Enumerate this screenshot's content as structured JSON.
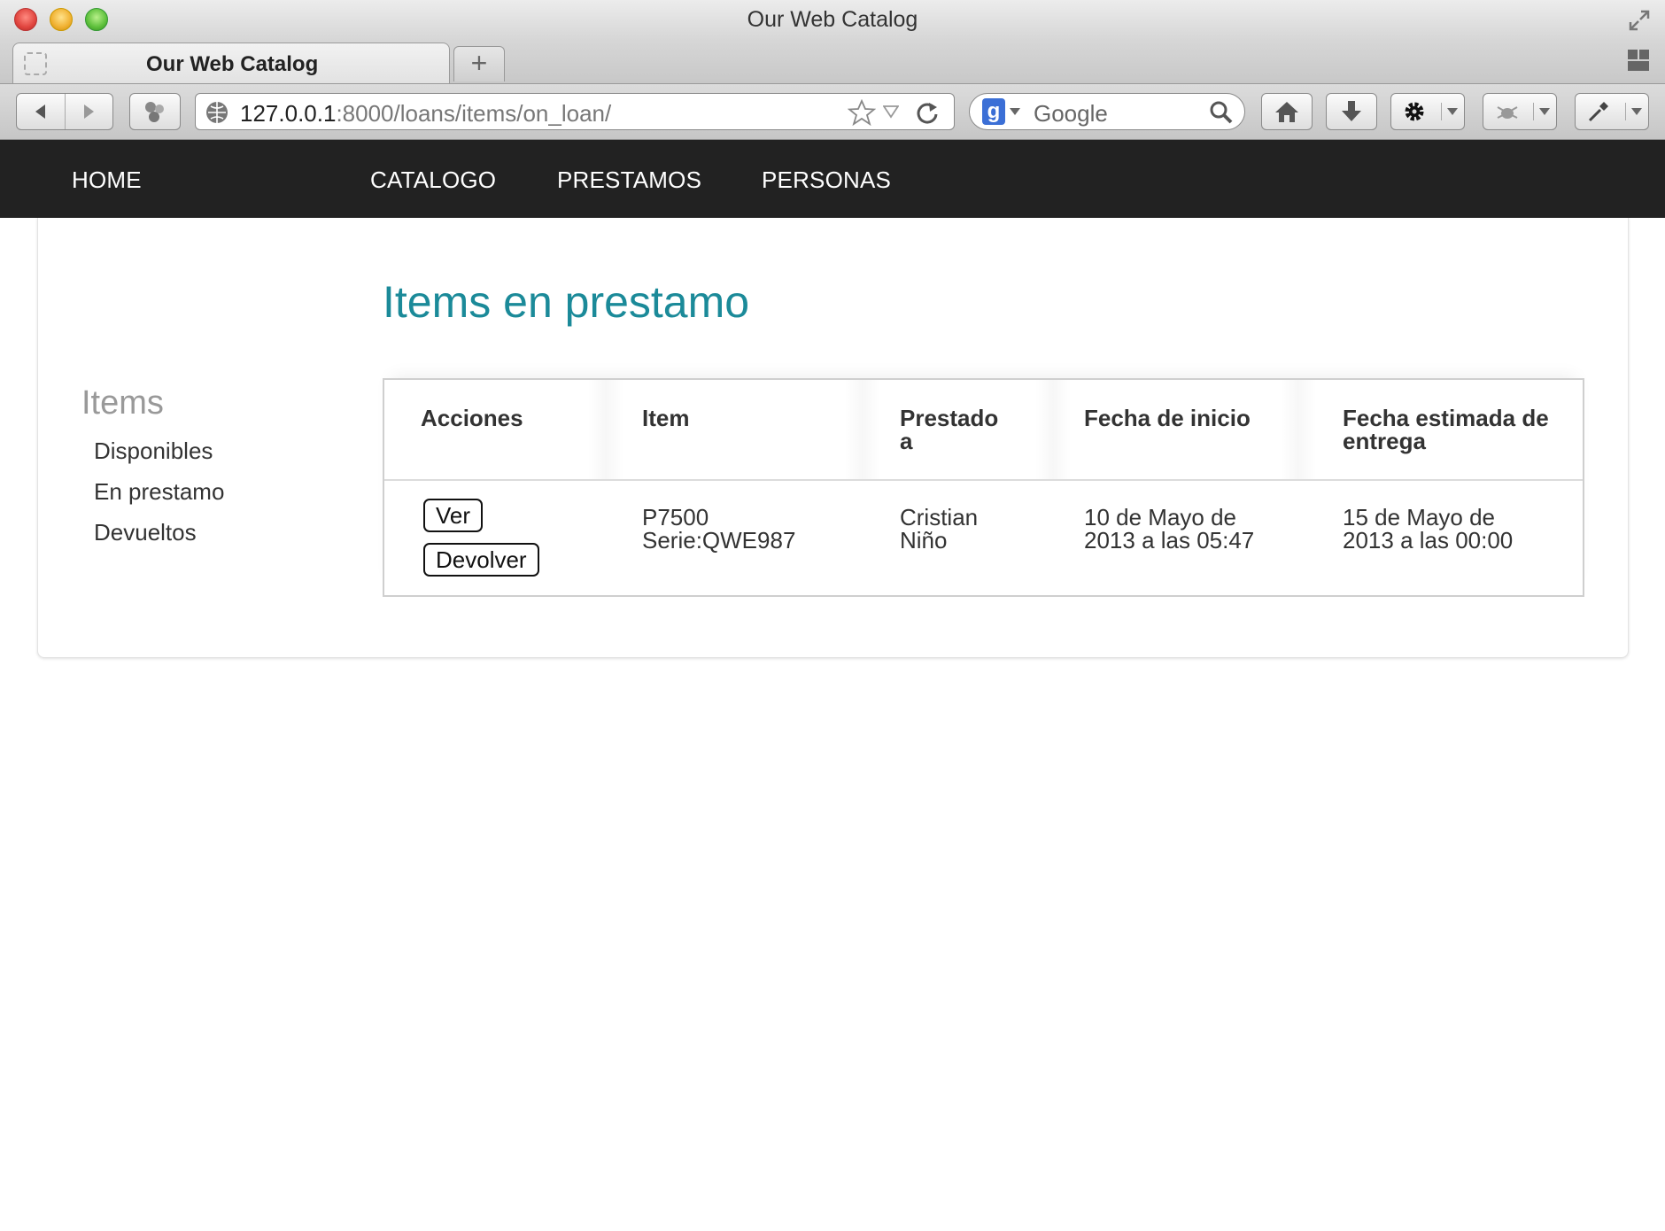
{
  "window": {
    "title": "Our Web Catalog"
  },
  "tabs": [
    {
      "label": "Our Web Catalog",
      "active": true
    }
  ],
  "new_tab_label": "+",
  "toolbar": {
    "url_host": "127.0.0.1",
    "url_rest": ":8000/loans/items/on_loan/",
    "search_placeholder": "Google"
  },
  "nav": {
    "home": "HOME",
    "catalogo": "CATALOGO",
    "prestamos": "PRESTAMOS",
    "personas": "PERSONAS"
  },
  "page": {
    "title": "Items en prestamo"
  },
  "sidebar": {
    "heading": "Items",
    "items": [
      {
        "label": "Disponibles"
      },
      {
        "label": "En prestamo"
      },
      {
        "label": "Devueltos"
      }
    ]
  },
  "table": {
    "headers": [
      "Acciones",
      "Item",
      "Prestado\na",
      "Fecha de inicio",
      "Fecha estimada de\nentrega"
    ],
    "rows": [
      {
        "actions": [
          "Ver",
          "Devolver"
        ],
        "item": "P7500\nSerie:QWE987",
        "prestado_a": "Cristian\nNiño",
        "fecha_inicio": "10 de Mayo de\n2013 a las 05:47",
        "fecha_entrega": "15 de Mayo de\n2013 a las 00:00"
      }
    ]
  },
  "colors": {
    "navbar": "#222222",
    "title_accent": "#1b8a99",
    "sidebar_heading": "#999999"
  }
}
